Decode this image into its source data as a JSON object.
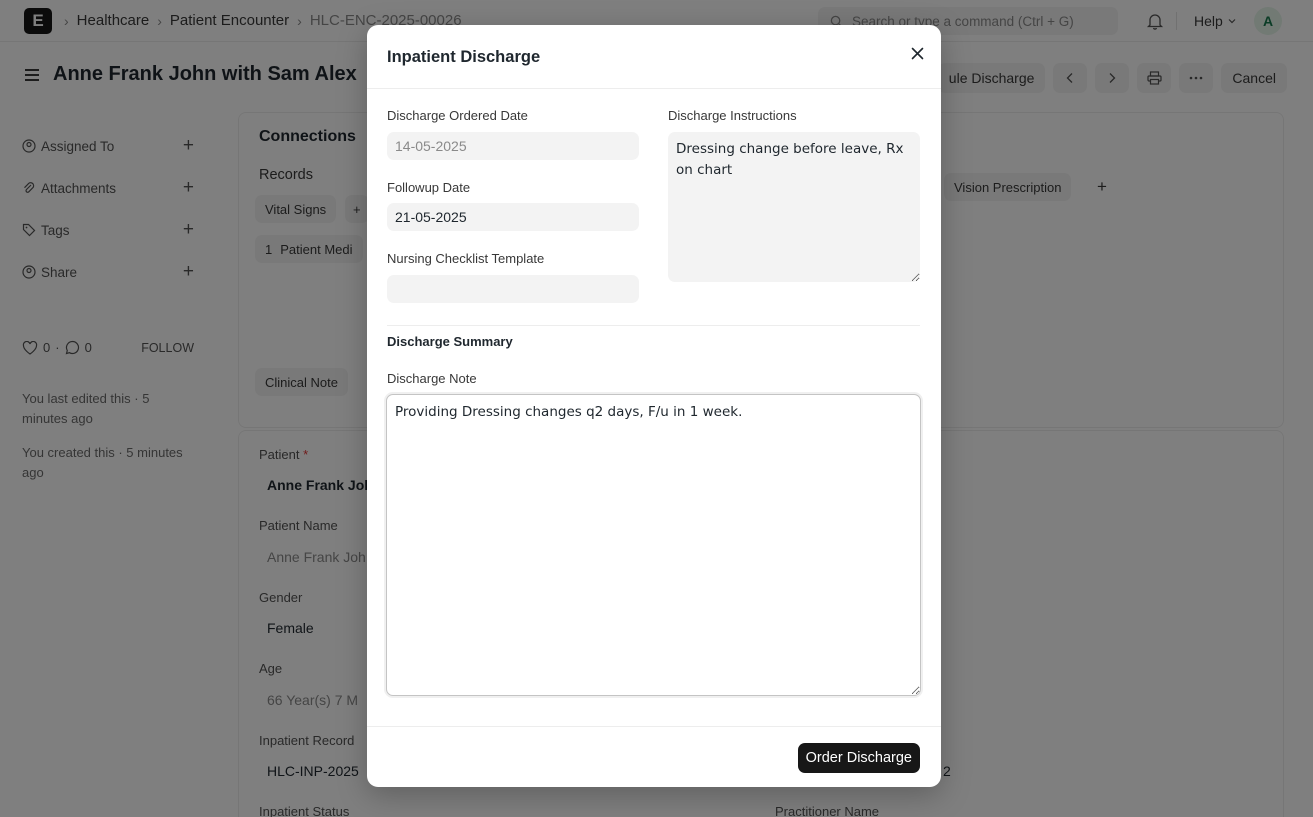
{
  "navbar": {
    "logo_letter": "E",
    "breadcrumbs": [
      "Healthcare",
      "Patient Encounter",
      "HLC-ENC-2025-00026"
    ],
    "search_placeholder": "Search or type a command (Ctrl + G)",
    "help_label": "Help",
    "avatar_initial": "A"
  },
  "page": {
    "title": "Anne Frank John with Sam Alex",
    "schedule_discharge_label": "ule Discharge",
    "cancel_label": "Cancel"
  },
  "sidebar": {
    "items": [
      {
        "label": "Assigned To"
      },
      {
        "label": "Attachments"
      },
      {
        "label": "Tags"
      },
      {
        "label": "Share"
      }
    ],
    "likes": "0",
    "comments": "0",
    "follow_label": "FOLLOW",
    "last_edited": "You last edited this · 5 minutes ago",
    "created": "You created this · 5 minutes ago"
  },
  "background": {
    "connections_title": "Connections",
    "records_title": "Records",
    "vital_signs": "Vital Signs",
    "vision_prescription": "Vision Prescription",
    "patient_medi_count": "1",
    "patient_medi_label": "Patient Medi",
    "clinical_note": "Clinical Note",
    "patient_label": "Patient",
    "patient_value": "Anne Frank Joh",
    "patient_name_label": "Patient Name",
    "patient_name_value": "Anne Frank Joh",
    "gender_label": "Gender",
    "gender_value": "Female",
    "age_label": "Age",
    "age_value": "66 Year(s) 7 M",
    "inpatient_record_label": "Inpatient Record",
    "inpatient_record_value": "HLC-INP-2025",
    "inpatient_status_label": "Inpatient Status",
    "practitioner_name_label": "Practitioner Name",
    "right_value_fragment": "2"
  },
  "modal": {
    "title": "Inpatient Discharge",
    "discharge_ordered_date_label": "Discharge Ordered Date",
    "discharge_ordered_date_value": "14-05-2025",
    "followup_date_label": "Followup Date",
    "followup_date_value": "21-05-2025",
    "nursing_checklist_label": "Nursing Checklist Template",
    "nursing_checklist_value": "",
    "discharge_instructions_label": "Discharge Instructions",
    "discharge_instructions_value": "Dressing change before leave, Rx on chart",
    "discharge_summary_title": "Discharge Summary",
    "discharge_note_label": "Discharge Note",
    "discharge_note_value": "Providing Dressing changes q2 days, F/u in 1 week.",
    "order_discharge_label": "Order Discharge"
  }
}
